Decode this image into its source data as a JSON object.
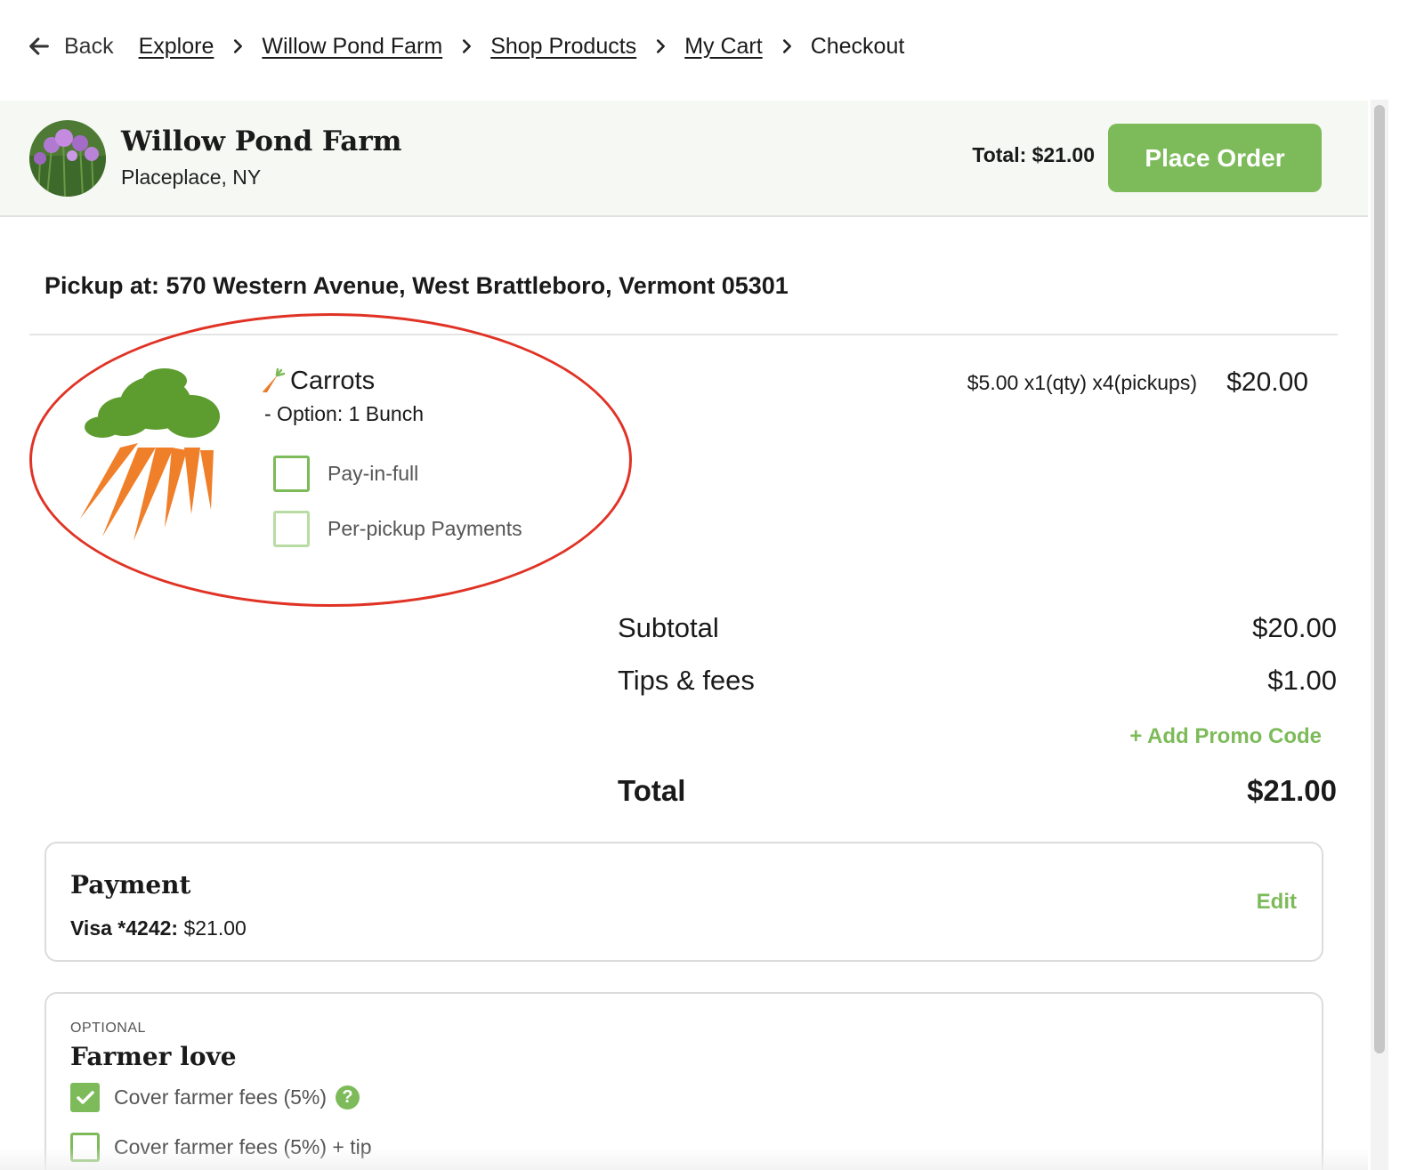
{
  "breadcrumb": {
    "back_label": "Back",
    "items": [
      "Explore",
      "Willow Pond Farm",
      "Shop Products",
      "My Cart"
    ],
    "current": "Checkout"
  },
  "farm": {
    "name": "Willow Pond Farm",
    "location": "Placeplace, NY",
    "total_label": "Total: $21.00",
    "place_order_label": "Place Order"
  },
  "pickup": {
    "text": "Pickup at: 570 Western Avenue, West Brattleboro, Vermont 05301"
  },
  "product": {
    "name": "Carrots",
    "option": "- Option: 1 Bunch",
    "price_detail": "$5.00 x1(qty) x4(pickups)",
    "line_total": "$20.00",
    "payment_options": [
      {
        "label": "Pay-in-full",
        "checked": false
      },
      {
        "label": "Per-pickup Payments",
        "checked": false
      }
    ]
  },
  "summary": {
    "subtotal_label": "Subtotal",
    "subtotal_value": "$20.00",
    "fees_label": "Tips & fees",
    "fees_value": "$1.00",
    "promo_label": "+ Add Promo Code",
    "total_label": "Total",
    "total_value": "$21.00"
  },
  "payment": {
    "title": "Payment",
    "card_label": "Visa *4242:",
    "card_amount": "$21.00",
    "edit_label": "Edit"
  },
  "farmer_love": {
    "optional_label": "OPTIONAL",
    "title": "Farmer love",
    "options": [
      {
        "label": "Cover farmer fees (5%)",
        "checked": true
      },
      {
        "label": "Cover farmer fees (5%) + tip",
        "checked": false
      }
    ],
    "help_glyph": "?"
  },
  "colors": {
    "accent_green": "#7dbb5a",
    "annotation_red": "#e03325",
    "band_bg": "#f5f8f3"
  }
}
